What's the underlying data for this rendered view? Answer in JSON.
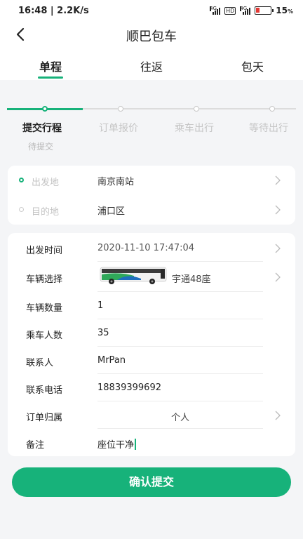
{
  "status_bar": {
    "time": "16:48 | 2.2K/s",
    "net1": "4G",
    "hd": "HD",
    "net2": "4G",
    "battery": "15",
    "battery_pct_sym": "%"
  },
  "header": {
    "title": "顺巴包车"
  },
  "tabs": [
    {
      "label": "单程"
    },
    {
      "label": "往返"
    },
    {
      "label": "包天"
    }
  ],
  "progress": {
    "steps": [
      "提交行程",
      "订单报价",
      "乘车出行",
      "等待出行"
    ],
    "current": 0,
    "status": "待提交"
  },
  "locations": {
    "from_label": "出发地",
    "from_value": "南京南站",
    "to_label": "目的地",
    "to_value": "浦口区"
  },
  "form": {
    "depart_time_label": "出发时间",
    "depart_time_value": "2020-11-10 17:47:04",
    "vehicle_label": "车辆选择",
    "vehicle_value": "宇通48座",
    "vehicle_count_label": "车辆数量",
    "vehicle_count_value": "1",
    "passengers_label": "乘车人数",
    "passengers_value": "35",
    "contact_label": "联系人",
    "contact_value": "MrPan",
    "phone_label": "联系电话",
    "phone_value": "18839399692",
    "owner_label": "订单归属",
    "owner_value": "个人",
    "remark_label": "备注",
    "remark_value": "座位干净"
  },
  "submit_label": "确认提交",
  "colors": {
    "accent": "#17b27a"
  }
}
